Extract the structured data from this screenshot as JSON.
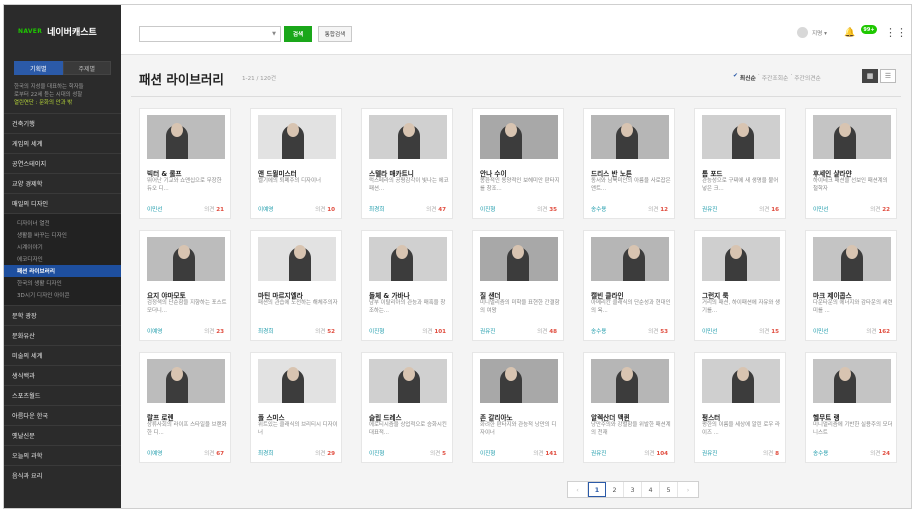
{
  "brand": {
    "naver": "NAVER",
    "cast": "네이버캐스트"
  },
  "sidebar": {
    "tabs": [
      {
        "label": "기획별"
      },
      {
        "label": "주제별"
      }
    ],
    "promo": {
      "line1": "한국의 지성을 대표하는 학자들",
      "line2": "로부터 22세 듣는 시대의 성찰",
      "highlight": "열린연단 : 문화의 안과 밖"
    },
    "items": [
      {
        "label": "건축기행"
      },
      {
        "label": "게임의 세계"
      },
      {
        "label": "공연스테이지"
      },
      {
        "label": "교양 경제학"
      },
      {
        "label": "매일의 디자인"
      }
    ],
    "sub_items": [
      {
        "label": "디자이너 열전"
      },
      {
        "label": "생활을 바꾸는 디자인"
      },
      {
        "label": "시계이야기"
      },
      {
        "label": "에코디자인"
      },
      {
        "label": "패션 라이브러리"
      },
      {
        "label": "한국의 생활 디자인"
      },
      {
        "label": "3D시기 디자인 아이콘"
      }
    ],
    "items_after": [
      {
        "label": "문학 광장"
      },
      {
        "label": "문화유산"
      },
      {
        "label": "미술의 세계"
      },
      {
        "label": "생식백과"
      },
      {
        "label": "스포츠월드"
      },
      {
        "label": "아름다운 한국"
      },
      {
        "label": "옛날신문"
      },
      {
        "label": "오늘의 과학"
      },
      {
        "label": "음식과 요리"
      }
    ]
  },
  "topbar": {
    "search_button": "검색",
    "all_search_button": "통합검색",
    "user_label": "지명 ▾",
    "cast_badge": "99+"
  },
  "header": {
    "title": "패션 라이브러리",
    "count": "1-21 / 120건",
    "sort": {
      "latest": "최신순",
      "weekly": "주간조회순",
      "weekly_comments": "주간의견순"
    }
  },
  "cards": [
    {
      "title": "빅터 & 롤프",
      "desc": "뛰어난 기교와 쇼맨십으로 무장한 듀오 디...",
      "author": "이민선",
      "comment_label": "의견",
      "comments": "21"
    },
    {
      "title": "앤 드뮐미스터",
      "desc": "벨기에의 퇴폐주의 디자이너",
      "author": "이예영",
      "comment_label": "의견",
      "comments": "10"
    },
    {
      "title": "스텔라 매카트니",
      "desc": "럭스페라의 공평감각이 빛나는 에코 패션...",
      "author": "최경희",
      "comment_label": "의견",
      "comments": "47"
    },
    {
      "title": "안나 수이",
      "desc": "몽환적인 동양적인 보헤미안 판타지를 창조...",
      "author": "이진형",
      "comment_label": "의견",
      "comments": "35"
    },
    {
      "title": "드리스 반 노튼",
      "desc": "동서와 남북미안의 아름을 사로잡은 앤트...",
      "author": "송수용",
      "comment_label": "의견",
      "comments": "12"
    },
    {
      "title": "톰 포드",
      "desc": "관능성으로 구찌에 새 생명을 불어넣은 크...",
      "author": "권유진",
      "comment_label": "의견",
      "comments": "16"
    },
    {
      "title": "후세인 샬라얀",
      "desc": "하이테크 패션을 선보인 패션계의 철학자",
      "author": "이민선",
      "comment_label": "의견",
      "comments": "22"
    },
    {
      "title": "요지 야마모토",
      "desc": "검정색의 단순함을 지향하는 포스트모더니...",
      "author": "이예영",
      "comment_label": "의견",
      "comments": "23"
    },
    {
      "title": "마틴 마르지엘라",
      "desc": "패션의 관습에 도전하는 해체주의자",
      "author": "최경희",
      "comment_label": "의견",
      "comments": "52"
    },
    {
      "title": "돌체 & 가바나",
      "desc": "남부 이탈리아의 관능과 매혹을 창조하는...",
      "author": "이진형",
      "comment_label": "의견",
      "comments": "101"
    },
    {
      "title": "질 샌더",
      "desc": "미니멀리즘의 미학을 표현한 간결함의 여왕",
      "author": "권유진",
      "comment_label": "의견",
      "comments": "48"
    },
    {
      "title": "캘빈 클라인",
      "desc": "아메리칸 클래식의 단순성과 현대인의 욕...",
      "author": "송수용",
      "comment_label": "의견",
      "comments": "53"
    },
    {
      "title": "그런지 룩",
      "desc": "거리의 패션, 하이패션에 자유와 생기를...",
      "author": "이민선",
      "comment_label": "의견",
      "comments": "15"
    },
    {
      "title": "마크 제이콥스",
      "desc": "다운타운의 에너지와 감타운의 세련미를 ...",
      "author": "이민선",
      "comment_label": "의견",
      "comments": "162"
    },
    {
      "title": "랄프 로렌",
      "desc": "상류사회의 라이프 스타일을 브랜화한 디...",
      "author": "이예영",
      "comment_label": "의견",
      "comments": "67"
    },
    {
      "title": "폴 스미스",
      "desc": "위트있는 클래식의 브리티시 디자이너",
      "author": "최경희",
      "comment_label": "의견",
      "comments": "29"
    },
    {
      "title": "슬립 드레스",
      "desc": "에로티시즘을 상업적으로 승화시킨 대표적...",
      "author": "이진형",
      "comment_label": "의견",
      "comments": "5"
    },
    {
      "title": "존 갈리아노",
      "desc": "화려한 판타지와 관능적 낭만의 디자이너",
      "author": "이진형",
      "comment_label": "의견",
      "comments": "141"
    },
    {
      "title": "알렉산더 맥퀸",
      "desc": "낭만주의와 강렬함을 위발한 패션계의 천재",
      "author": "권유진",
      "comment_label": "의견",
      "comments": "104"
    },
    {
      "title": "펑스터",
      "desc": "펑한의 이름을 세상에 알린 로우 라이즈 ...",
      "author": "권유진",
      "comment_label": "의견",
      "comments": "8"
    },
    {
      "title": "헬무트 랭",
      "desc": "미니멀리즘에 기반한 실용주의 모더니스트",
      "author": "송수용",
      "comment_label": "의견",
      "comments": "24"
    }
  ],
  "pagination": {
    "prev": "‹",
    "next": "›",
    "pages": [
      "1",
      "2",
      "3",
      "4",
      "5"
    ],
    "current": "1"
  },
  "colors": {
    "sidebar_bg": "#2b2b2b",
    "accent": "#2b5aa8",
    "naver_green": "#1ec800",
    "comment_red": "#e04b3d"
  }
}
